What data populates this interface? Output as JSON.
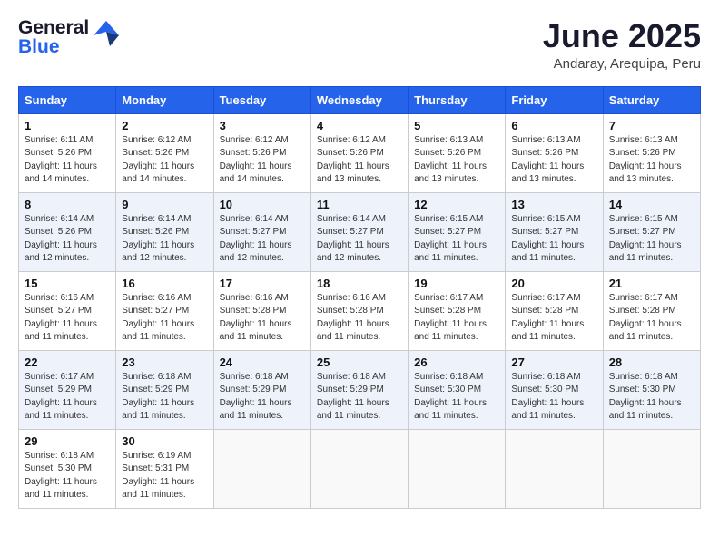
{
  "header": {
    "logo_general": "General",
    "logo_blue": "Blue",
    "month_title": "June 2025",
    "location": "Andaray, Arequipa, Peru"
  },
  "days_of_week": [
    "Sunday",
    "Monday",
    "Tuesday",
    "Wednesday",
    "Thursday",
    "Friday",
    "Saturday"
  ],
  "weeks": [
    [
      {
        "day": "1",
        "info": "Sunrise: 6:11 AM\nSunset: 5:26 PM\nDaylight: 11 hours\nand 14 minutes."
      },
      {
        "day": "2",
        "info": "Sunrise: 6:12 AM\nSunset: 5:26 PM\nDaylight: 11 hours\nand 14 minutes."
      },
      {
        "day": "3",
        "info": "Sunrise: 6:12 AM\nSunset: 5:26 PM\nDaylight: 11 hours\nand 14 minutes."
      },
      {
        "day": "4",
        "info": "Sunrise: 6:12 AM\nSunset: 5:26 PM\nDaylight: 11 hours\nand 13 minutes."
      },
      {
        "day": "5",
        "info": "Sunrise: 6:13 AM\nSunset: 5:26 PM\nDaylight: 11 hours\nand 13 minutes."
      },
      {
        "day": "6",
        "info": "Sunrise: 6:13 AM\nSunset: 5:26 PM\nDaylight: 11 hours\nand 13 minutes."
      },
      {
        "day": "7",
        "info": "Sunrise: 6:13 AM\nSunset: 5:26 PM\nDaylight: 11 hours\nand 13 minutes."
      }
    ],
    [
      {
        "day": "8",
        "info": "Sunrise: 6:14 AM\nSunset: 5:26 PM\nDaylight: 11 hours\nand 12 minutes."
      },
      {
        "day": "9",
        "info": "Sunrise: 6:14 AM\nSunset: 5:26 PM\nDaylight: 11 hours\nand 12 minutes."
      },
      {
        "day": "10",
        "info": "Sunrise: 6:14 AM\nSunset: 5:27 PM\nDaylight: 11 hours\nand 12 minutes."
      },
      {
        "day": "11",
        "info": "Sunrise: 6:14 AM\nSunset: 5:27 PM\nDaylight: 11 hours\nand 12 minutes."
      },
      {
        "day": "12",
        "info": "Sunrise: 6:15 AM\nSunset: 5:27 PM\nDaylight: 11 hours\nand 11 minutes."
      },
      {
        "day": "13",
        "info": "Sunrise: 6:15 AM\nSunset: 5:27 PM\nDaylight: 11 hours\nand 11 minutes."
      },
      {
        "day": "14",
        "info": "Sunrise: 6:15 AM\nSunset: 5:27 PM\nDaylight: 11 hours\nand 11 minutes."
      }
    ],
    [
      {
        "day": "15",
        "info": "Sunrise: 6:16 AM\nSunset: 5:27 PM\nDaylight: 11 hours\nand 11 minutes."
      },
      {
        "day": "16",
        "info": "Sunrise: 6:16 AM\nSunset: 5:27 PM\nDaylight: 11 hours\nand 11 minutes."
      },
      {
        "day": "17",
        "info": "Sunrise: 6:16 AM\nSunset: 5:28 PM\nDaylight: 11 hours\nand 11 minutes."
      },
      {
        "day": "18",
        "info": "Sunrise: 6:16 AM\nSunset: 5:28 PM\nDaylight: 11 hours\nand 11 minutes."
      },
      {
        "day": "19",
        "info": "Sunrise: 6:17 AM\nSunset: 5:28 PM\nDaylight: 11 hours\nand 11 minutes."
      },
      {
        "day": "20",
        "info": "Sunrise: 6:17 AM\nSunset: 5:28 PM\nDaylight: 11 hours\nand 11 minutes."
      },
      {
        "day": "21",
        "info": "Sunrise: 6:17 AM\nSunset: 5:28 PM\nDaylight: 11 hours\nand 11 minutes."
      }
    ],
    [
      {
        "day": "22",
        "info": "Sunrise: 6:17 AM\nSunset: 5:29 PM\nDaylight: 11 hours\nand 11 minutes."
      },
      {
        "day": "23",
        "info": "Sunrise: 6:18 AM\nSunset: 5:29 PM\nDaylight: 11 hours\nand 11 minutes."
      },
      {
        "day": "24",
        "info": "Sunrise: 6:18 AM\nSunset: 5:29 PM\nDaylight: 11 hours\nand 11 minutes."
      },
      {
        "day": "25",
        "info": "Sunrise: 6:18 AM\nSunset: 5:29 PM\nDaylight: 11 hours\nand 11 minutes."
      },
      {
        "day": "26",
        "info": "Sunrise: 6:18 AM\nSunset: 5:30 PM\nDaylight: 11 hours\nand 11 minutes."
      },
      {
        "day": "27",
        "info": "Sunrise: 6:18 AM\nSunset: 5:30 PM\nDaylight: 11 hours\nand 11 minutes."
      },
      {
        "day": "28",
        "info": "Sunrise: 6:18 AM\nSunset: 5:30 PM\nDaylight: 11 hours\nand 11 minutes."
      }
    ],
    [
      {
        "day": "29",
        "info": "Sunrise: 6:18 AM\nSunset: 5:30 PM\nDaylight: 11 hours\nand 11 minutes."
      },
      {
        "day": "30",
        "info": "Sunrise: 6:19 AM\nSunset: 5:31 PM\nDaylight: 11 hours\nand 11 minutes."
      },
      {
        "day": "",
        "info": ""
      },
      {
        "day": "",
        "info": ""
      },
      {
        "day": "",
        "info": ""
      },
      {
        "day": "",
        "info": ""
      },
      {
        "day": "",
        "info": ""
      }
    ]
  ]
}
